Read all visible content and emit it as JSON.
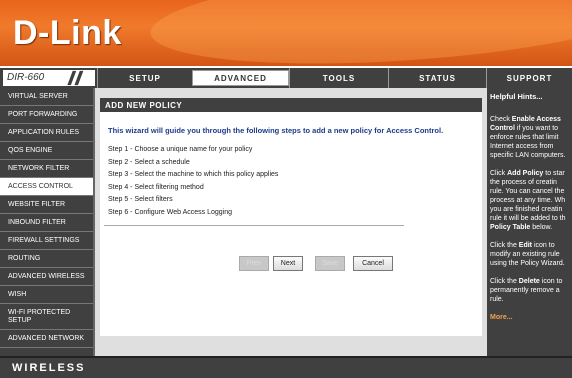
{
  "brand": {
    "logo_text": "D-Link"
  },
  "model": {
    "name": "DIR-660"
  },
  "tabs": [
    {
      "label": "SETUP",
      "active": false
    },
    {
      "label": "ADVANCED",
      "active": true
    },
    {
      "label": "TOOLS",
      "active": false
    },
    {
      "label": "STATUS",
      "active": false
    },
    {
      "label": "SUPPORT",
      "active": false
    }
  ],
  "sidebar": {
    "items": [
      {
        "label": "VIRTUAL SERVER"
      },
      {
        "label": "PORT FORWARDING"
      },
      {
        "label": "APPLICATION RULES"
      },
      {
        "label": "QOS ENGINE"
      },
      {
        "label": "NETWORK FILTER"
      },
      {
        "label": "ACCESS CONTROL",
        "active": true
      },
      {
        "label": "WEBSITE FILTER"
      },
      {
        "label": "INBOUND FILTER"
      },
      {
        "label": "FIREWALL SETTINGS"
      },
      {
        "label": "ROUTING"
      },
      {
        "label": "ADVANCED WIRELESS"
      },
      {
        "label": "WISH"
      },
      {
        "label": "WI-FI PROTECTED SETUP"
      },
      {
        "label": "ADVANCED NETWORK"
      }
    ]
  },
  "main": {
    "title": "ADD NEW POLICY",
    "intro": "This wizard will guide you through the following steps to add a new policy for Access Control.",
    "steps": [
      "Step 1 - Choose a unique name for your policy",
      "Step 2 - Select a schedule",
      "Step 3 - Select the machine to which this policy applies",
      "Step 4 - Select filtering method",
      "Step 5 - Select filters",
      "Step 6 - Configure Web Access Logging"
    ],
    "buttons": {
      "prev": "Prev",
      "next": "Next",
      "save": "Save",
      "cancel": "Cancel"
    }
  },
  "hints": {
    "title": "Helpful Hints...",
    "p1_pre": "Check ",
    "p1_bold": "Enable Access",
    "p1_bold2": "Control",
    "p1_rest": [
      " if you want to",
      "enforce rules that limit",
      "Internet access from",
      "specific LAN computers."
    ],
    "p2_pre": "Click ",
    "p2_bold": "Add Policy",
    "p2_mid": " to star",
    "p2_lines": [
      "the process of creatin",
      "rule. You can cancel the",
      "process at any time. Wh",
      "you are finished creatin",
      "rule it will be added to th"
    ],
    "p2_bold2": "Policy Table",
    "p2_end": " below.",
    "p3_pre": "Click the ",
    "p3_bold": "Edit",
    "p3_mid": " icon to",
    "p3_lines": [
      "modify an existing rule",
      "using the Policy Wizard."
    ],
    "p4_pre": "Click the ",
    "p4_bold": "Delete",
    "p4_mid": " icon to",
    "p4_lines": [
      "permanently remove a",
      "rule."
    ],
    "more": "More..."
  },
  "footer": {
    "text": "WIRELESS"
  },
  "colors": {
    "banner": "#e8641c",
    "dark": "#404040",
    "intro_blue": "#1c3c8c",
    "more": "#f2a24e"
  }
}
